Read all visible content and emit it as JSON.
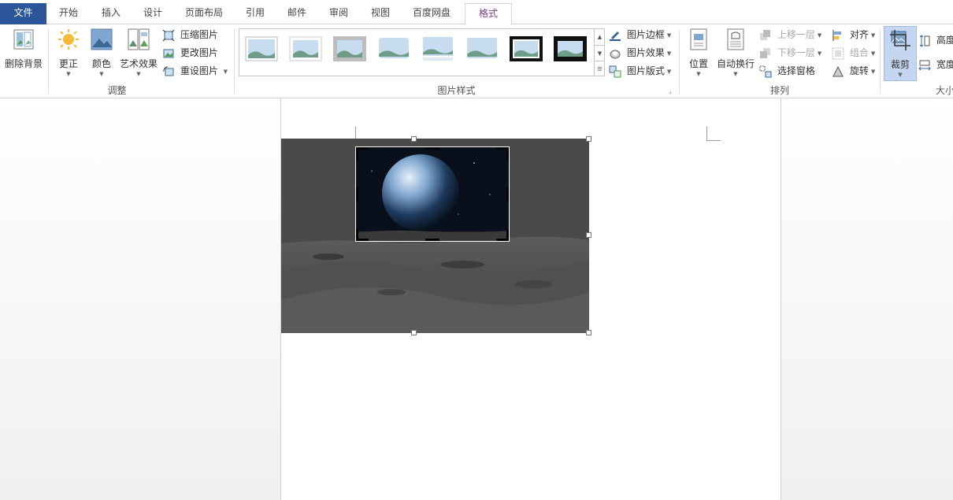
{
  "tabs": [
    {
      "id": "file",
      "label": "文件"
    },
    {
      "id": "home",
      "label": "开始"
    },
    {
      "id": "insert",
      "label": "插入"
    },
    {
      "id": "design",
      "label": "设计"
    },
    {
      "id": "layout",
      "label": "页面布局"
    },
    {
      "id": "references",
      "label": "引用"
    },
    {
      "id": "mailings",
      "label": "邮件"
    },
    {
      "id": "review",
      "label": "审阅"
    },
    {
      "id": "view",
      "label": "视图"
    },
    {
      "id": "baidu",
      "label": "百度网盘"
    },
    {
      "id": "format",
      "label": "格式"
    }
  ],
  "ribbon": {
    "adjust": {
      "label": "调整",
      "remove_bg": "删除背景",
      "corrections": "更正",
      "color": "颜色",
      "artistic": "艺术效果",
      "compress": "压缩图片",
      "change": "更改图片",
      "reset": "重设图片"
    },
    "styles": {
      "label": "图片样式",
      "border": "图片边框",
      "effects": "图片效果",
      "layout": "图片版式"
    },
    "arrange": {
      "label": "排列",
      "position": "位置",
      "wrap": "自动换行",
      "forward": "上移一层",
      "backward": "下移一层",
      "selection_pane": "选择窗格",
      "align": "对齐",
      "group": "组合",
      "rotate": "旋转"
    },
    "size": {
      "label": "大小",
      "crop": "裁剪",
      "height": "高度",
      "width": "宽度"
    }
  },
  "colors": {
    "file_tab": "#2b579a",
    "active_tab_text": "#7b3a8a",
    "crop_highlight": "#c5d7f0"
  }
}
